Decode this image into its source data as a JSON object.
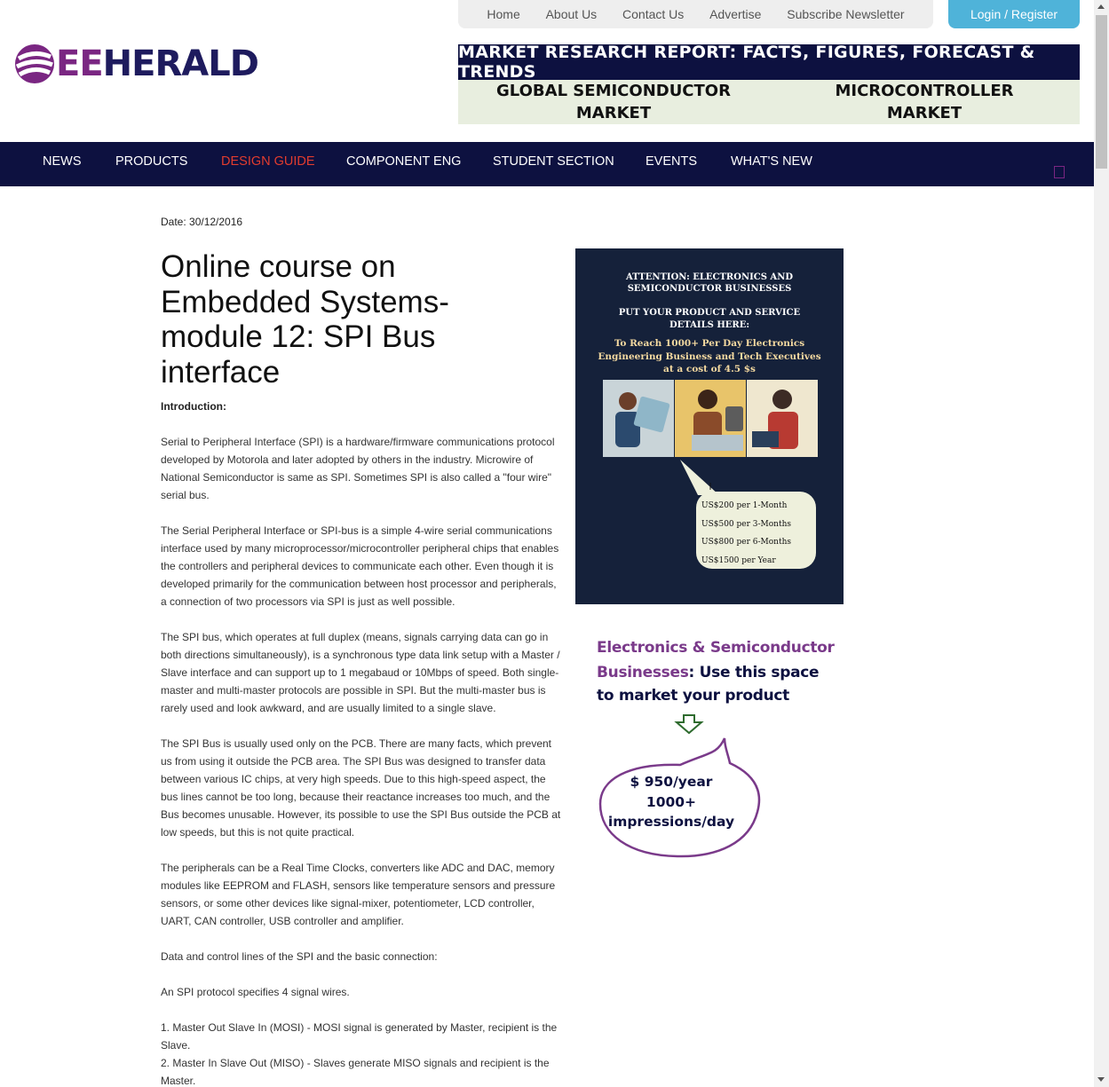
{
  "topnav": {
    "items": [
      "Home",
      "About Us",
      "Contact Us",
      "Advertise",
      "Subscribe Newsletter"
    ],
    "login": "Login / Register"
  },
  "logo": {
    "part1": "EE",
    "part2": "HERALD"
  },
  "banner": {
    "title": "MARKET RESEARCH REPORT: FACTS, FIGURES, FORECAST & TRENDS",
    "cells": [
      {
        "line1": "GLOBAL SEMICONDUCTOR",
        "line2": "MARKET"
      },
      {
        "line1": "MICROCONTROLLER",
        "line2": "MARKET"
      }
    ]
  },
  "mainnav": {
    "items": [
      "NEWS",
      "PRODUCTS",
      "DESIGN GUIDE",
      "COMPONENT ENG",
      "STUDENT SECTION",
      "EVENTS",
      "WHAT'S NEW"
    ],
    "active_index": 2,
    "active_color": "#e23c2e"
  },
  "article": {
    "date": "Date: 30/12/2016",
    "title": "Online course on Embedded Systems-module 12: SPI Bus interface",
    "intro_label": "Introduction:",
    "paragraphs": [
      "Serial to Peripheral Interface (SPI) is a hardware/firmware communications protocol developed by Motorola and later adopted by others in the industry. Microwire of National Semiconductor is same as SPI. Sometimes SPI is also called a \"four wire\" serial bus.",
      "The Serial Peripheral Interface or SPI-bus is a simple 4-wire serial communications interface used by many microprocessor/microcontroller peripheral chips that enables the controllers and peripheral devices to communicate each other. Even though it is developed primarily for the communication between host processor and peripherals, a connection of two processors via SPI is just as well possible.",
      "The SPI bus, which operates at full duplex (means, signals carrying data can go in both directions simultaneously), is a synchronous type data link setup with a Master / Slave interface and can support up to 1 megabaud or 10Mbps of speed. Both single-master and multi-master protocols are possible in SPI. But the multi-master bus is rarely used and look awkward, and are usually limited to a single slave.",
      "The SPI Bus is usually used only on the PCB. There are many facts, which prevent us from using it outside the PCB area. The SPI Bus was designed to transfer data between various IC chips, at very high speeds. Due to this high-speed aspect, the bus lines cannot be too long, because their reactance increases too much, and the Bus becomes unusable. However, its possible to use the SPI Bus outside the PCB at low speeds, but this is not quite practical.",
      "The peripherals can be a Real Time Clocks, converters like ADC and DAC, memory modules like EEPROM and FLASH, sensors like temperature sensors and pressure sensors, or some other devices like signal-mixer, potentiometer, LCD controller, UART, CAN controller, USB controller and amplifier.",
      "Data and control lines of the SPI and the basic connection:",
      "An SPI protocol specifies 4 signal wires."
    ],
    "list": [
      "1. Master Out Slave In (MOSI) - MOSI signal is generated by Master, recipient is the Slave.",
      "2. Master In Slave Out (MISO) - Slaves generate MISO signals and recipient is the Master."
    ]
  },
  "ad1": {
    "attention": [
      "ATTENTION: ELECTRONICS AND",
      "SEMICONDUCTOR  BUSINESSES"
    ],
    "put": [
      "PUT YOUR PRODUCT AND SERVICE",
      "DETAILS HERE:"
    ],
    "reach": [
      "To Reach 1000+ Per Day Electronics",
      "Engineering Business and Tech Executives",
      "at a cost of 4.5 $s"
    ],
    "prices": [
      "US$200 per 1-Month",
      "US$500 per 3-Months",
      "US$800 per 6-Months",
      "US$1500 per Year"
    ]
  },
  "ad2": {
    "line1": "Electronics & Semiconductor",
    "line2a": "Businesses",
    "line2b": ": Use this space",
    "line3": "to market your product",
    "bubble": [
      "$ 950/year",
      "1000+",
      "impressions/day"
    ]
  },
  "colors": {
    "navy": "#0d1140",
    "purple": "#7a2682",
    "login": "#4fb3d9"
  }
}
